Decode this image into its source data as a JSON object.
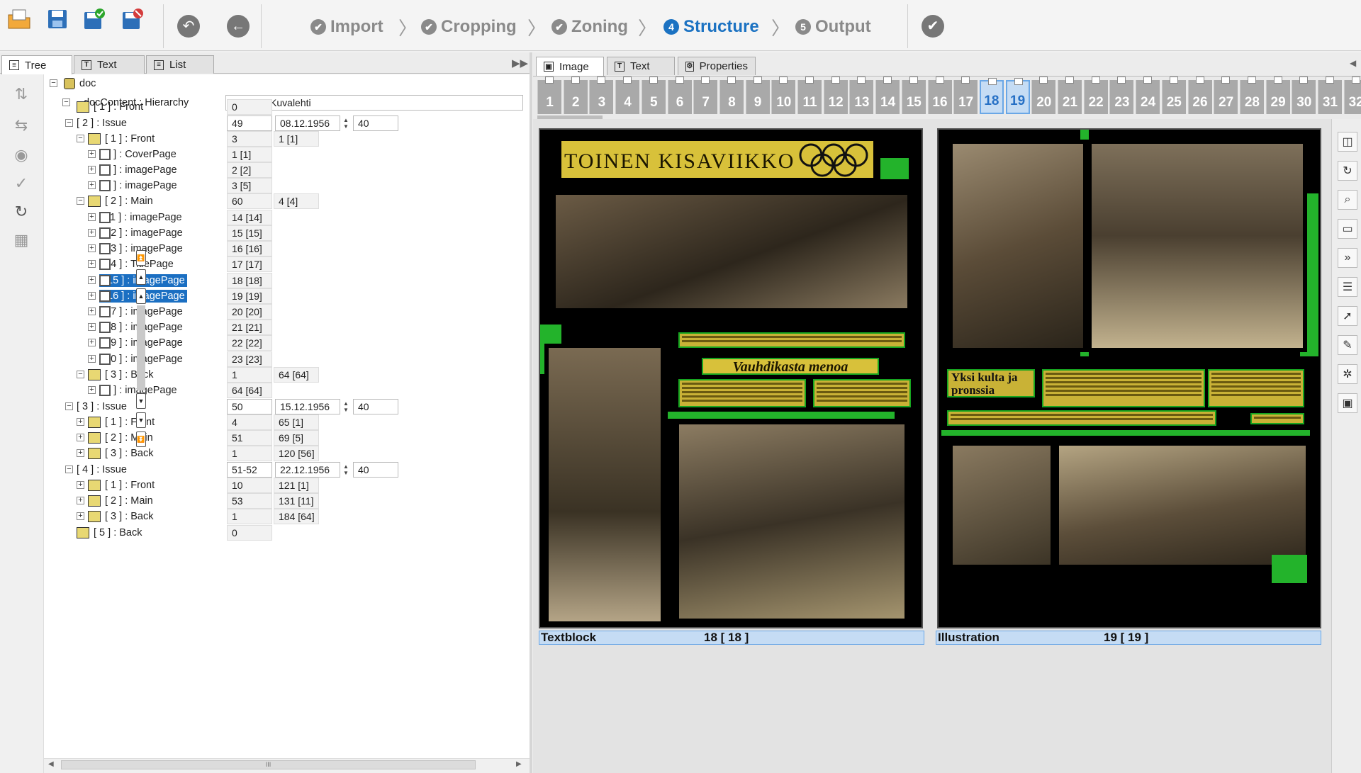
{
  "toolbar": {
    "steps": [
      {
        "num": "✔",
        "label": "Import"
      },
      {
        "num": "✔",
        "label": "Cropping"
      },
      {
        "num": "✔",
        "label": "Zoning"
      },
      {
        "num": "4",
        "label": "Structure"
      },
      {
        "num": "5",
        "label": "Output"
      }
    ],
    "active_step": "Structure"
  },
  "left_tabs": [
    "Tree",
    "Text",
    "List"
  ],
  "right_tabs": [
    "Image",
    "Text",
    "Properties"
  ],
  "tree": {
    "root": "doc",
    "content": "docContent : Hierarchy",
    "content_value": "Suomen Kuvalehti",
    "rows": [
      {
        "label": "[ 1 ] : Front",
        "f1": "0"
      },
      {
        "label": "[ 2 ] : Issue",
        "f1": "49",
        "f2": "08.12.1956",
        "f3": "40"
      },
      {
        "label": "[ 1 ] : Front",
        "f1": "3",
        "f2": "1 [1]"
      },
      {
        "label": "[ 1 ] : CoverPage",
        "f1": "1 [1]"
      },
      {
        "label": "[ 2 ] : imagePage",
        "f1": "2 [2]"
      },
      {
        "label": "[ 3 ] : imagePage",
        "f1": "3 [5]"
      },
      {
        "label": "[ 2 ] : Main",
        "f1": "60",
        "f2": "4 [4]"
      },
      {
        "label": "[ 11 ] : imagePage",
        "f1": "14 [14]"
      },
      {
        "label": "[ 12 ] : imagePage",
        "f1": "15 [15]"
      },
      {
        "label": "[ 13 ] : imagePage",
        "f1": "16 [16]"
      },
      {
        "label": "[ 14 ] : TitlePage",
        "f1": "17 [17]"
      },
      {
        "label": "[ 15 ] : imagePage",
        "f1": "18 [18]"
      },
      {
        "label": "[ 16 ] : imagePage",
        "f1": "19 [19]"
      },
      {
        "label": "[ 17 ] : imagePage",
        "f1": "20 [20]"
      },
      {
        "label": "[ 18 ] : imagePage",
        "f1": "21 [21]"
      },
      {
        "label": "[ 19 ] : imagePage",
        "f1": "22 [22]"
      },
      {
        "label": "[ 20 ] : imagePage",
        "f1": "23 [23]"
      },
      {
        "label": "[ 3 ] : Back",
        "f1": "1",
        "f2": "64 [64]"
      },
      {
        "label": "[ 1 ] : imagePage",
        "f1": "64 [64]"
      },
      {
        "label": "[ 3 ] : Issue",
        "f1": "50",
        "f2": "15.12.1956",
        "f3": "40"
      },
      {
        "label": "[ 1 ] : Front",
        "f1": "4",
        "f2": "65 [1]"
      },
      {
        "label": "[ 2 ] : Main",
        "f1": "51",
        "f2": "69 [5]"
      },
      {
        "label": "[ 3 ] : Back",
        "f1": "1",
        "f2": "120 [56]"
      },
      {
        "label": "[ 4 ] : Issue",
        "f1": "51-52",
        "f2": "22.12.1956",
        "f3": "40"
      },
      {
        "label": "[ 1 ] : Front",
        "f1": "10",
        "f2": "121 [1]"
      },
      {
        "label": "[ 2 ] : Main",
        "f1": "53",
        "f2": "131 [11]"
      },
      {
        "label": "[ 3 ] : Back",
        "f1": "1",
        "f2": "184 [64]"
      },
      {
        "label": "[ 5 ] : Back",
        "f1": "0"
      }
    ],
    "selected": [
      "[ 15 ] : imagePage",
      "[ 16 ] : imagePage"
    ]
  },
  "page_strip": {
    "pages": [
      "1",
      "2",
      "3",
      "4",
      "5",
      "6",
      "7",
      "8",
      "9",
      "10",
      "11",
      "12",
      "13",
      "14",
      "15",
      "16",
      "17",
      "18",
      "19",
      "20",
      "21",
      "22",
      "23",
      "24",
      "25",
      "26",
      "27",
      "28",
      "29",
      "30",
      "31",
      "32"
    ],
    "current": [
      "18",
      "19"
    ]
  },
  "spread": {
    "left": {
      "headline": "TOINEN KISAVIIKKO",
      "subhead": "Vauhdikasta menoa",
      "caption_type": "Textblock",
      "caption_page": "18 [ 18 ]"
    },
    "right": {
      "subhead": "Yksi kulta ja pronssia",
      "caption_type": "Illustration",
      "caption_page": "19 [ 19 ]"
    }
  },
  "scrollbar": {
    "thumb": "III"
  },
  "icons": {
    "toolbar": [
      "open-folder-icon",
      "save-icon",
      "save-approve-icon",
      "save-reject-icon",
      "undo-icon",
      "back-icon",
      "finish-icon"
    ],
    "left_tools": [
      "move-node-icon",
      "split-node-icon",
      "approve-node-icon",
      "check-node-icon",
      "refresh-icon",
      "layout-icon"
    ],
    "right_tools": [
      "double-page-icon",
      "rotate-icon",
      "zoom-icon",
      "single-page-icon",
      "next-pages-icon",
      "text-lines-icon",
      "pointer-icon",
      "draw-icon",
      "film-icon",
      "frame-icon"
    ]
  },
  "colors": {
    "accent": "#1b72c2",
    "zone": "#23b32b",
    "selection": "#1b6fc2"
  }
}
